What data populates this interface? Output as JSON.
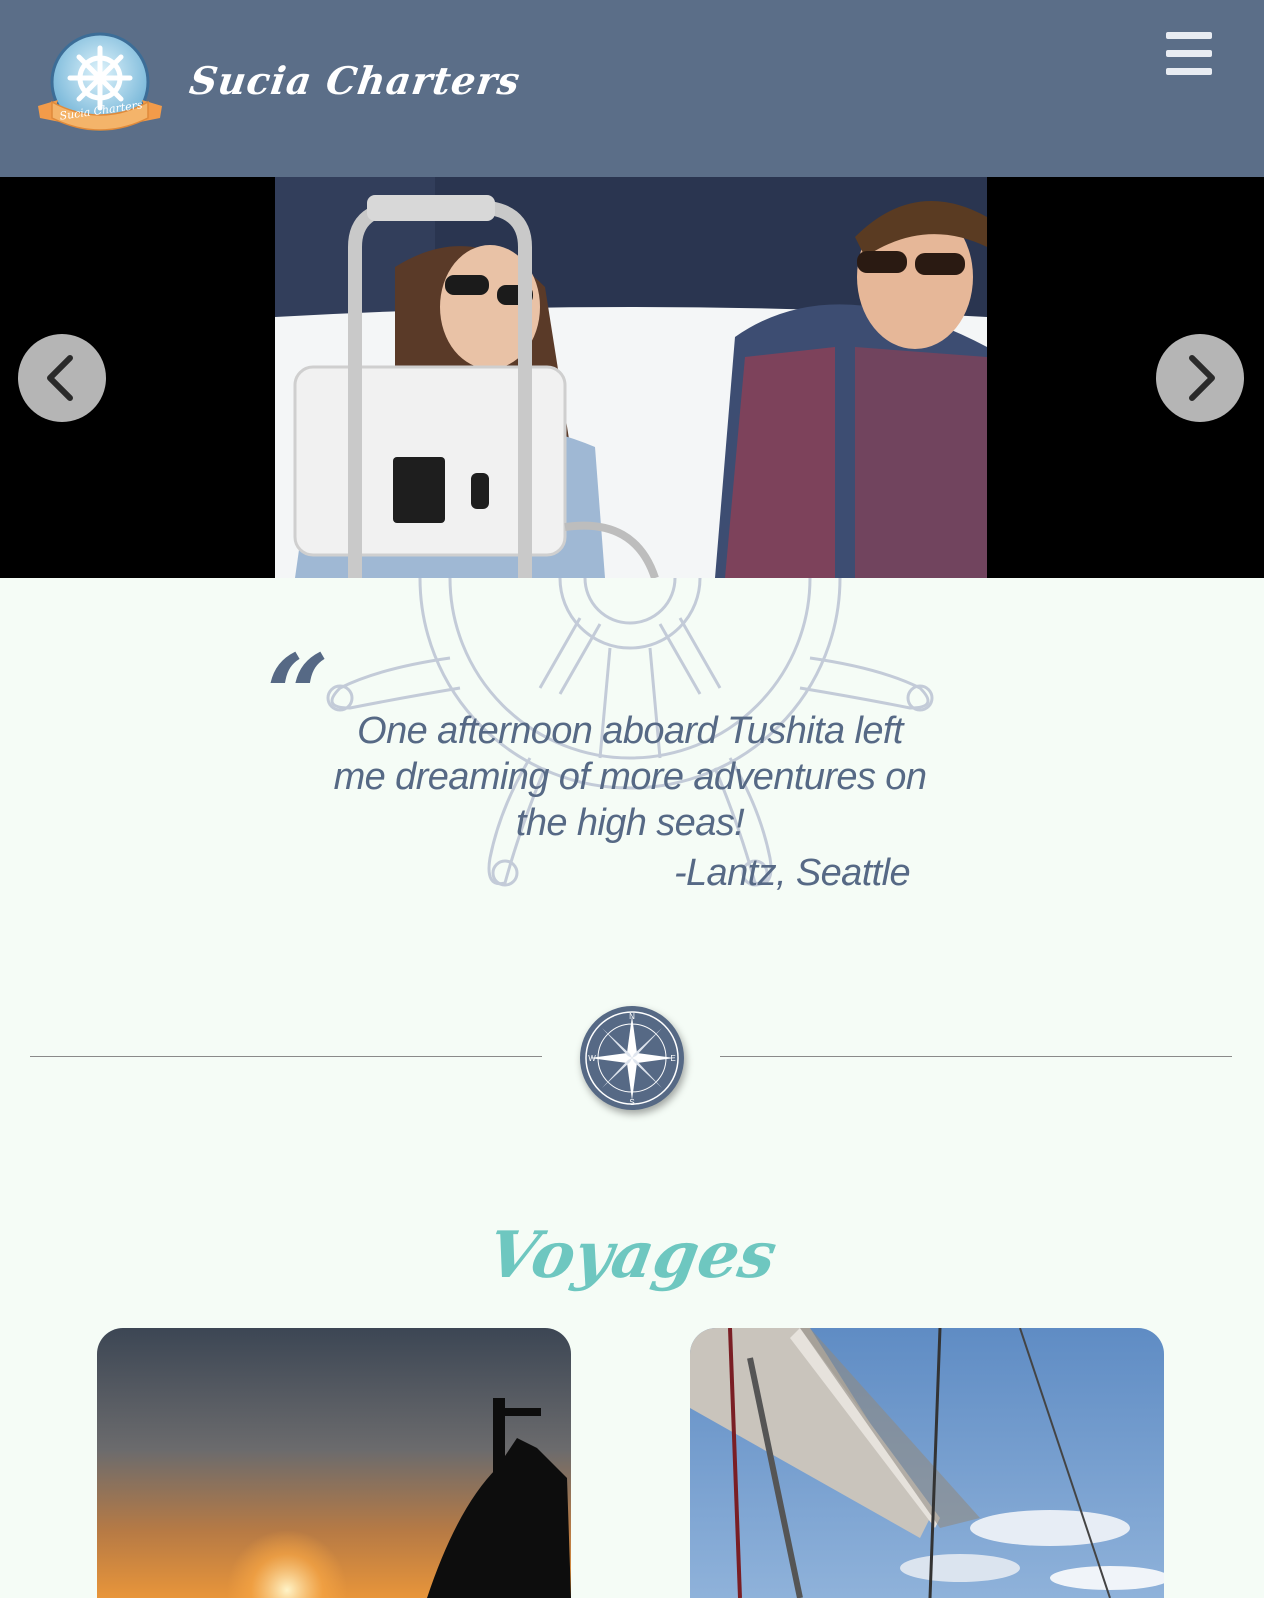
{
  "header": {
    "brand_title": "Sucia Charters",
    "logo_banner_text": "Sucia Charters",
    "background_color": "#5b6e88"
  },
  "carousel": {
    "prev_icon": "chevron-left-icon",
    "next_icon": "chevron-right-icon",
    "slide_description_icon": "photo"
  },
  "testimonial": {
    "quote_mark": "“",
    "text": "One afternoon aboard Tushita left me dreaming of more adventures on the high seas!",
    "author": "-Lantz, Seattle",
    "text_color": "#566985"
  },
  "divider": {
    "icon": "compass-icon",
    "compass_points": [
      "N",
      "E",
      "S",
      "W"
    ]
  },
  "voyages": {
    "title": "Voyages",
    "title_color": "#6ec7c0"
  },
  "colors": {
    "page_background": "#f5fcf6",
    "accent": "#6ec7c0"
  }
}
